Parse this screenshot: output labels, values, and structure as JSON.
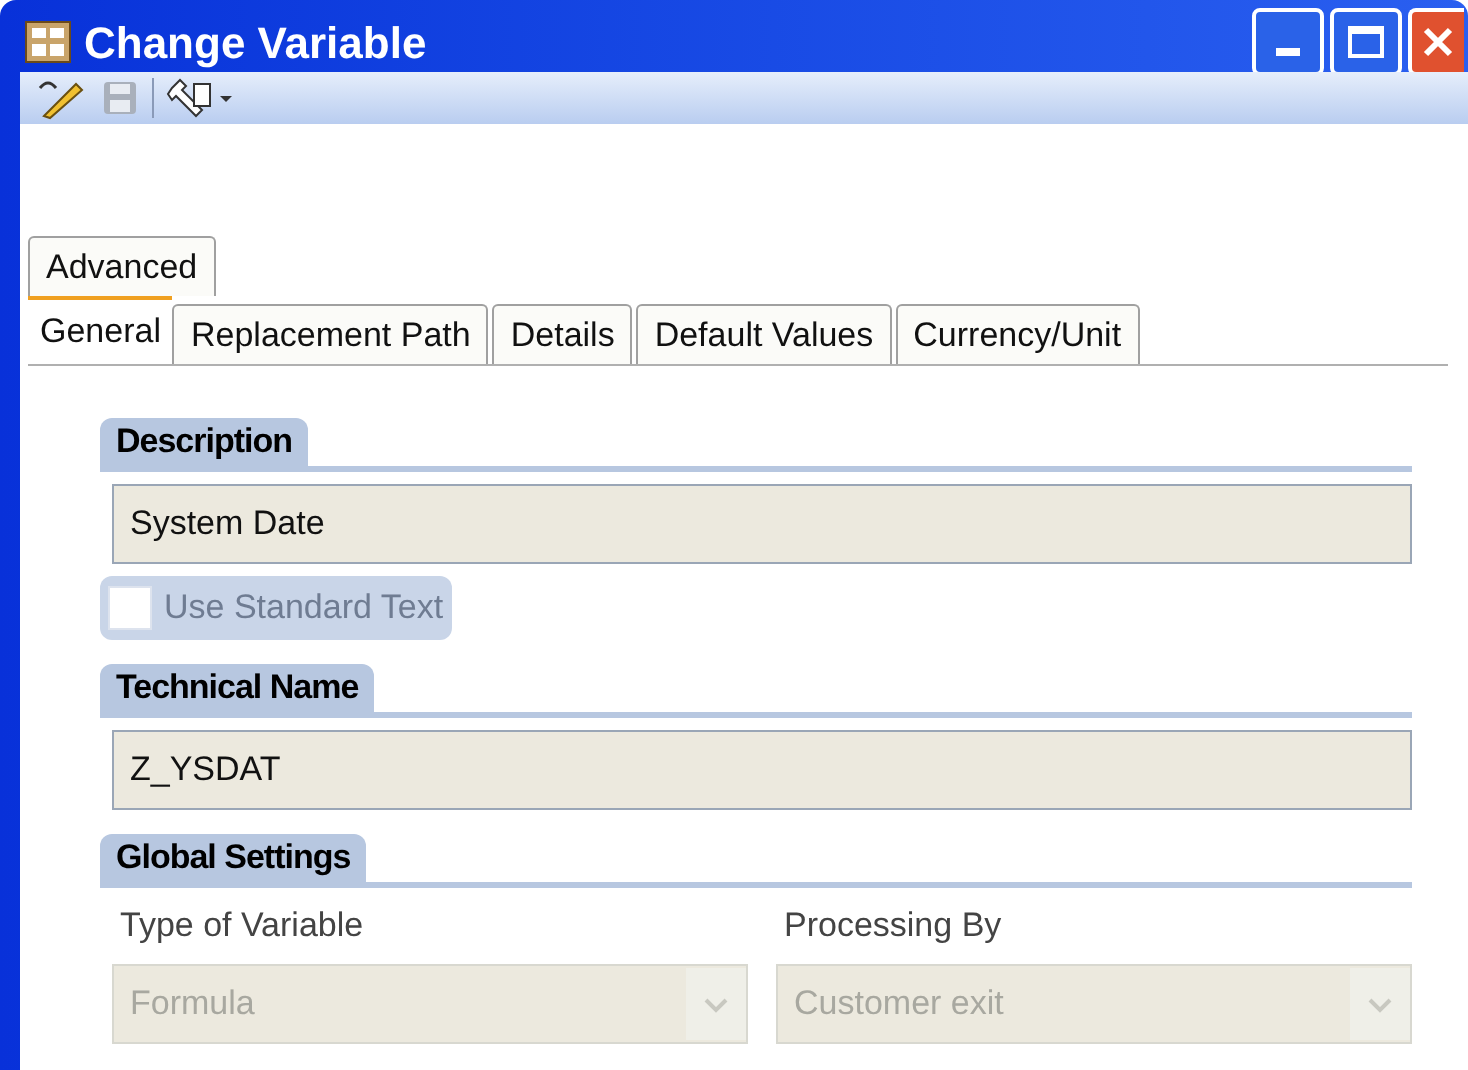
{
  "window": {
    "title": "Change Variable"
  },
  "tab_rows": [
    [
      {
        "label": "Advanced",
        "selected": false
      }
    ],
    [
      {
        "label": "General",
        "selected": true
      },
      {
        "label": "Replacement Path",
        "selected": false
      },
      {
        "label": "Details",
        "selected": false
      },
      {
        "label": "Default Values",
        "selected": false
      },
      {
        "label": "Currency/Unit",
        "selected": false
      }
    ]
  ],
  "description": {
    "title": "Description",
    "value": "System Date",
    "checkbox": {
      "label": "Use Standard Text",
      "checked": false,
      "disabled": true
    }
  },
  "technical_name": {
    "title": "Technical Name",
    "value": "Z_YSDAT"
  },
  "global_settings": {
    "title": "Global Settings",
    "fields": [
      {
        "label": "Type of Variable",
        "value": "Formula",
        "disabled": true
      },
      {
        "label": "Processing By",
        "value": "Customer exit",
        "disabled": true
      }
    ]
  }
}
